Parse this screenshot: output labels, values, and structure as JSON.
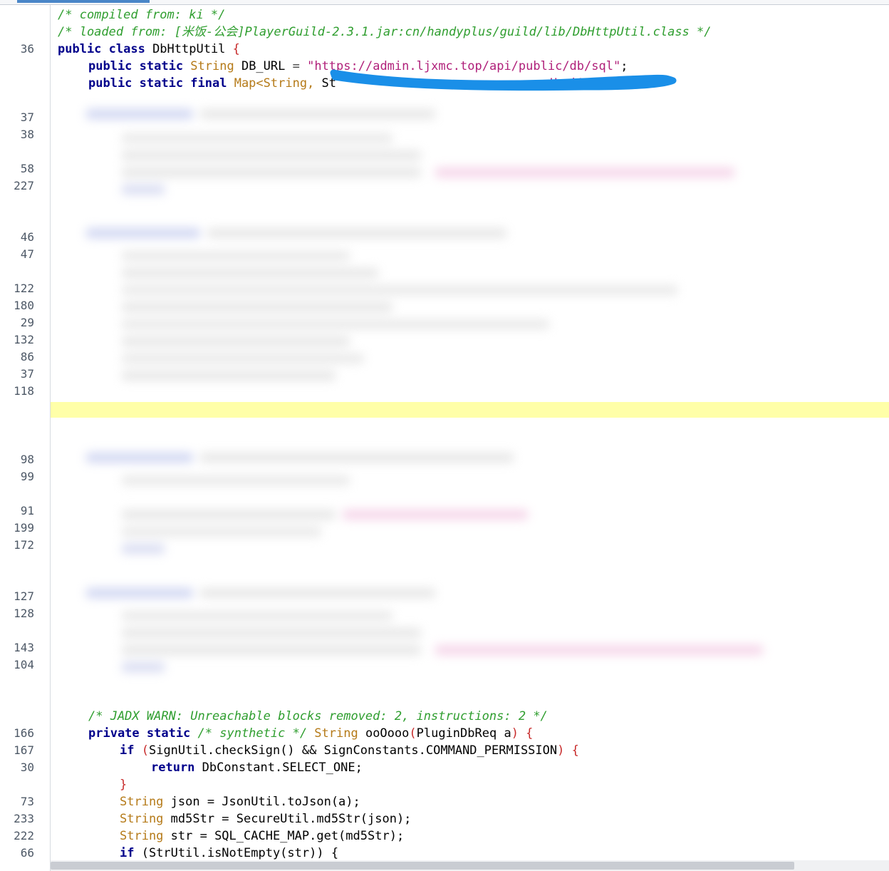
{
  "line_numbers": [
    "36",
    "37",
    "38",
    "58",
    "227",
    "46",
    "47",
    "122",
    "180",
    "29",
    "132",
    "86",
    "37",
    "118",
    "98",
    "99",
    "91",
    "199",
    "172",
    "127",
    "128",
    "143",
    "104",
    "166",
    "167",
    "30",
    "73",
    "233",
    "222",
    "66"
  ],
  "header_lines": {
    "compiled_from": "/* compiled from: ki */",
    "loaded_from": "/* loaded from: [米饭-公会]PlayerGuild-2.3.1.jar:cn/handyplus/guild/lib/DbHttpUtil.class */"
  },
  "class_decl": {
    "kw": "public class",
    "name": " DbHttpUtil ",
    "brace": "{"
  },
  "field1": {
    "kw": "public static",
    "type": " String",
    "name": " DB_URL ",
    "eq": "=",
    "value": " \"https://admin.ljxmc.top/api/public/db/sql\"",
    "end": ";"
  },
  "field2": {
    "kw": "public static final",
    "type": " Map<String,",
    "rest": " St",
    "tail": "HashMap();"
  },
  "warn_comment": "/* JADX WARN: Unreachable blocks removed: 2, instructions: 2 */",
  "method_sig": {
    "kw": "private static",
    "comment": " /* synthetic */",
    "type": " String",
    "name": " ooOooo",
    "paren": "(",
    "param": "PluginDbReq a",
    "close": ") {"
  },
  "code_lines": {
    "if1": {
      "kw": "if",
      "cond": " (",
      "body": "SignUtil.checkSign() && SignConstants.COMMAND_PERMISSION",
      "end": ") {"
    },
    "ret": {
      "kw": "return",
      "body": " DbConstant.SELECT_ONE;"
    },
    "close_brace": "}",
    "json": {
      "type": "String",
      "body": " json = JsonUtil.toJson(a);"
    },
    "md5": {
      "type": "String",
      "body": " md5Str = SecureUtil.md5Str(json);"
    },
    "str": {
      "type": "String",
      "body": " str = SQL_CACHE_MAP.get(md5Str);"
    },
    "if2": {
      "kw": "if",
      "body": " (StrUtil.isNotEmpty(str)) {"
    }
  },
  "colors": {
    "comment": "#2f9e2f",
    "keyword": "#00008b",
    "type": "#b57a18",
    "string": "#b0207a",
    "redaction": "#1a8fe8",
    "highlight": "#ffffa8"
  }
}
